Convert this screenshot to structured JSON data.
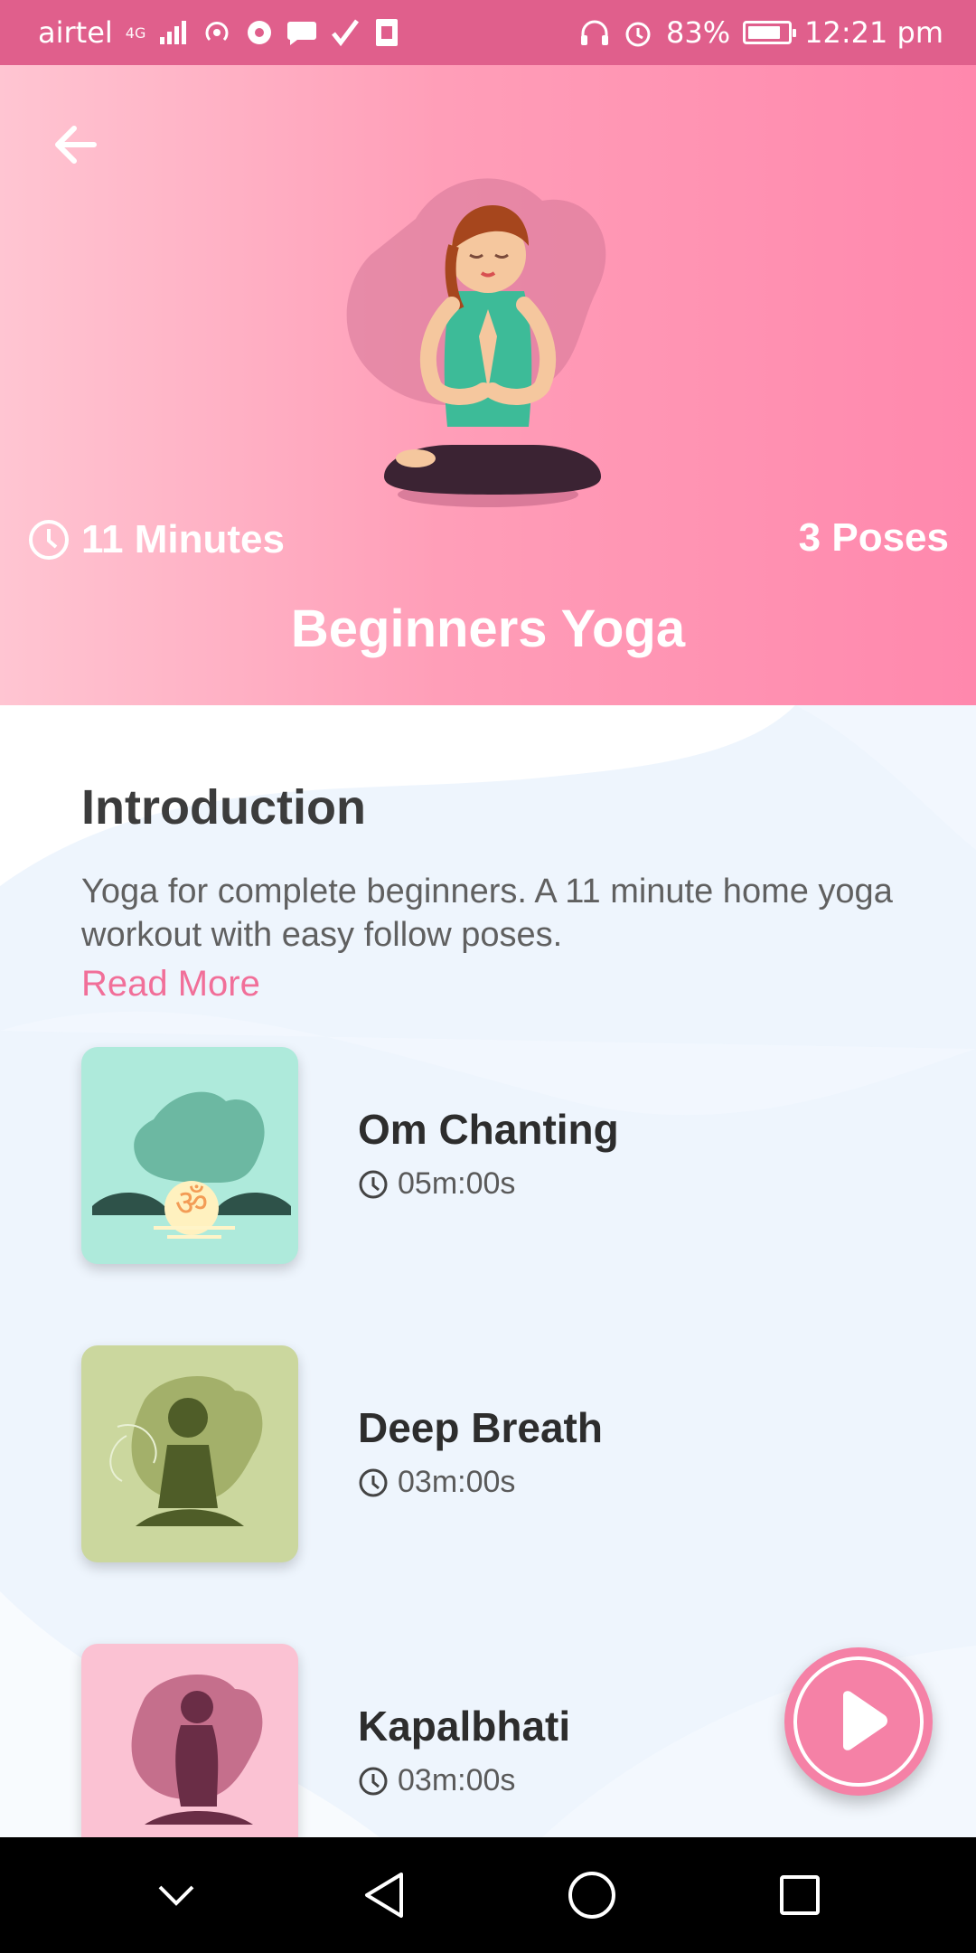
{
  "status_bar": {
    "carrier": "airtel",
    "network": "4G",
    "battery": "83%",
    "battery_level": 0.83,
    "time": "12:21 pm",
    "icons": [
      "signal-icon",
      "hotspot-icon",
      "chrome-icon",
      "message-icon",
      "check-icon",
      "sim-icon",
      "headphones-icon",
      "alarm-icon",
      "battery-icon"
    ]
  },
  "header": {
    "minutes": "11 Minutes",
    "poses": "3 Poses",
    "title": "Beginners Yoga",
    "colors": {
      "gradient_start": "#ffc5d2",
      "gradient_end": "#ff88ad"
    }
  },
  "intro": {
    "title": "Introduction",
    "text": "Yoga for complete beginners. A 11 minute home yoga workout with easy follow poses.",
    "read_more": "Read More"
  },
  "poses": [
    {
      "name": "Om Chanting",
      "duration": "05m:00s",
      "card_color": "#aeeadb"
    },
    {
      "name": "Deep Breath",
      "duration": "03m:00s",
      "card_color": "#cbd79e"
    },
    {
      "name": "Kapalbhati",
      "duration": "03m:00s",
      "card_color": "#fbc2d3"
    }
  ],
  "accent_color": "#f16f99"
}
